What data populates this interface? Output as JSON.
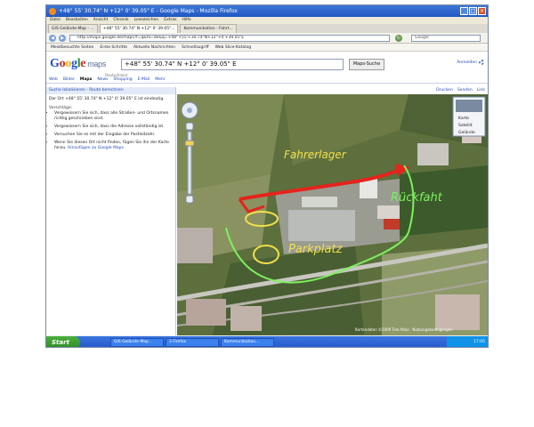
{
  "window": {
    "title": "+48° 55' 30.74\" N +12° 0' 39.05\" E - Google Maps - Mozilla Firefox",
    "buttons": {
      "minimize": "_",
      "maximize": "□",
      "close": "×"
    }
  },
  "menubar": [
    "Datei",
    "Bearbeiten",
    "Ansicht",
    "Chronik",
    "Lesezeichen",
    "Extras",
    "Hilfe"
  ],
  "tabs": [
    {
      "label": "GIS Gelände-Map - ..."
    },
    {
      "label": "+48° 55' 30.74\" N +12° 0' 39.05\"..."
    },
    {
      "label": "Kommunikation - Fahrt..."
    }
  ],
  "navbar": {
    "url": "http://maps.google.de/maps?f=q&hl=de&q=+48°+55'+30.74\"N+12°+0'+39.05\"E",
    "search_placeholder": "Google",
    "back": "◀",
    "forward": "▶",
    "reload": "↻"
  },
  "bookmarks": [
    "Meistbesuchte Seiten",
    "Erste Schritte",
    "Aktuelle Nachrichten",
    "Schnellzugriff",
    "Web Slice-Katalog"
  ],
  "google": {
    "logo_letters": [
      "G",
      "o",
      "o",
      "g",
      "l",
      "e"
    ],
    "logo_maps": "maps",
    "beta": "Deutschland",
    "search_value": "+48° 55' 30.74\" N +12° 0' 39.05\" E",
    "search_button": "Maps-Suche",
    "anmelden": "Anmelden",
    "nav": [
      "Web",
      "Bilder",
      "Maps",
      "News",
      "Shopping",
      "E-Mail",
      "Mehr"
    ],
    "nav_selected": "Maps"
  },
  "sidebar": {
    "header": "Suche lokalisieren - Route berechnen",
    "paragraph": "Der Ort +48° 55' 30.74\" N +12° 0' 39.05\" E ist eindeutig.",
    "sub": "Vorschläge:",
    "list": [
      "Vergewissern Sie sich, dass alle Straßen- und Ortsnamen richtig geschrieben sind.",
      "Vergewissern Sie sich, dass die Adresse vollständig ist.",
      "Versuchen Sie es mit der Eingabe der Postleitzahl.",
      "Wenn Sie diesen Ort nicht finden, fügen Sie ihn der Karte hinzu."
    ],
    "link": "Hinzufügen zu Google Maps"
  },
  "map": {
    "bar": [
      "Drucken",
      "Senden",
      "Link"
    ],
    "type_buttons": [
      "Karte",
      "Satellit",
      "Gelände"
    ],
    "annotations": {
      "arrival": "Fahrerlager",
      "parking": "Parkplatz",
      "exit": "Rückfaht"
    },
    "copyright": "Kartendaten ©2009 Tele Atlas - Nutzungsbedingungen"
  },
  "taskbar": {
    "start": "Start",
    "items": [
      "GIS Gelände-Map...",
      "2 Firefox",
      "Kommunikation..."
    ],
    "clock": "17:05"
  }
}
